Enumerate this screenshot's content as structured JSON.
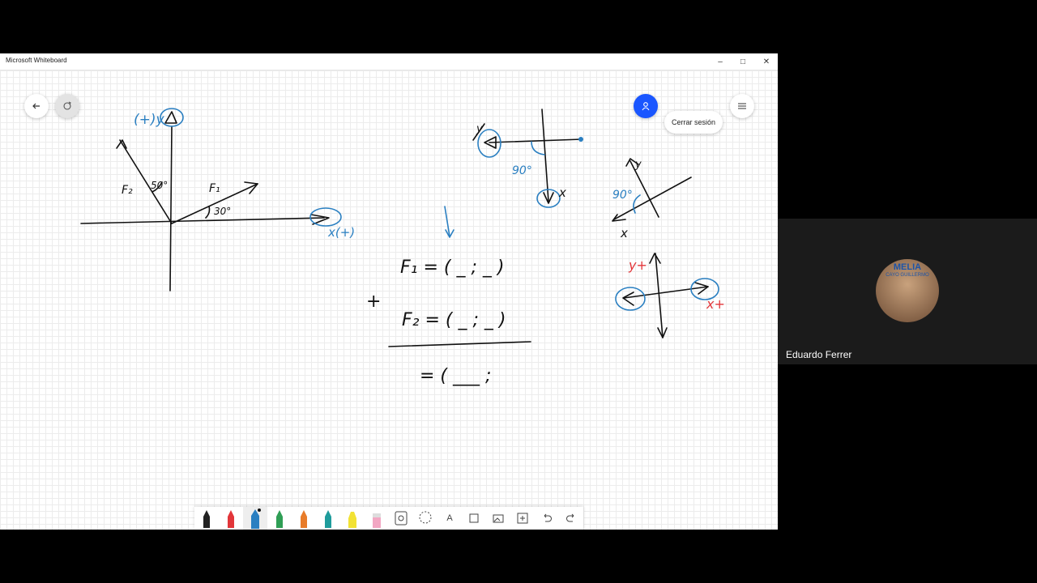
{
  "window": {
    "title": "Microsoft Whiteboard",
    "minimize": "–",
    "maximize": "□",
    "close": "✕"
  },
  "header": {
    "signout_label": "Cerrar sesión"
  },
  "whiteboard": {
    "diagram1": {
      "y_label": "(+)y",
      "f2": "F₂",
      "angle_top": "50°",
      "f1": "F₁",
      "angle_bottom": "30°",
      "x_label": "x(+)"
    },
    "diagram2": {
      "y_label": "y",
      "angle": "90°",
      "x_label": "x"
    },
    "diagram3": {
      "y_label": "y",
      "angle": "90°",
      "x_label": "x"
    },
    "diagram4": {
      "y_label": "y+",
      "x_label": "x+"
    },
    "equation": {
      "row1": "F₁ = ( _ ; _ )",
      "plus": "+",
      "row2": "F₂ = ( _ ; _ )",
      "result": "= ( ___ ;"
    }
  },
  "toolbar": {
    "tools": [
      "pen-black",
      "pen-red",
      "pen-blue",
      "pen-green",
      "pen-orange",
      "pen-teal",
      "highlighter-yellow",
      "eraser",
      "ruler",
      "lasso",
      "text",
      "note",
      "image",
      "insert",
      "undo",
      "redo"
    ],
    "text_tool_label": "A"
  },
  "participant": {
    "name": "Eduardo Ferrer",
    "avatar_text": "MELIA",
    "avatar_subtext": "CAYO GUILLERMO"
  },
  "colors": {
    "accent": "#1a56ff",
    "ink_blue": "#2a7fc1",
    "ink_red": "#e2363a"
  }
}
